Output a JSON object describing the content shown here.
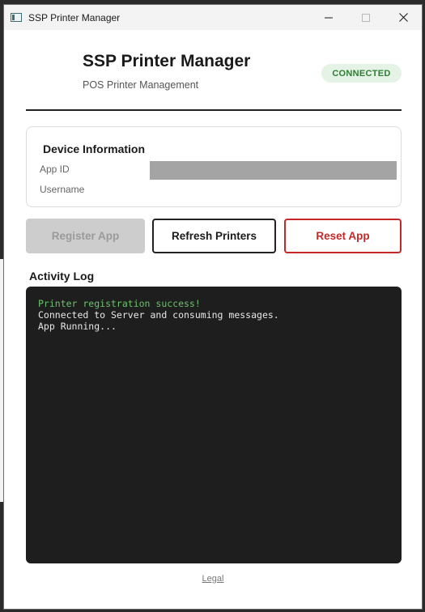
{
  "window": {
    "title": "SSP Printer Manager"
  },
  "header": {
    "title": "SSP Printer Manager",
    "subtitle": "POS Printer Management",
    "status": "CONNECTED"
  },
  "device_info": {
    "title": "Device Information",
    "fields": [
      {
        "label": "App ID",
        "value": ""
      },
      {
        "label": "Username",
        "value": ""
      }
    ]
  },
  "actions": {
    "register_label": "Register App",
    "refresh_label": "Refresh Printers",
    "reset_label": "Reset App"
  },
  "activity_log": {
    "title": "Activity Log",
    "lines": [
      "Printer registration success!",
      "Connected to Server and consuming messages.",
      "App Running..."
    ]
  },
  "footer": {
    "legal_label": "Legal"
  },
  "colors": {
    "status_text": "#2e7d32",
    "status_bg": "#e4f3e6",
    "reset_accent": "#c62828",
    "log_bg": "#1e1e1e",
    "log_success": "#6cc26c"
  },
  "icons": {
    "app": "printer-app-icon",
    "minimize": "minimize-icon",
    "maximize": "maximize-icon",
    "close": "close-icon"
  }
}
